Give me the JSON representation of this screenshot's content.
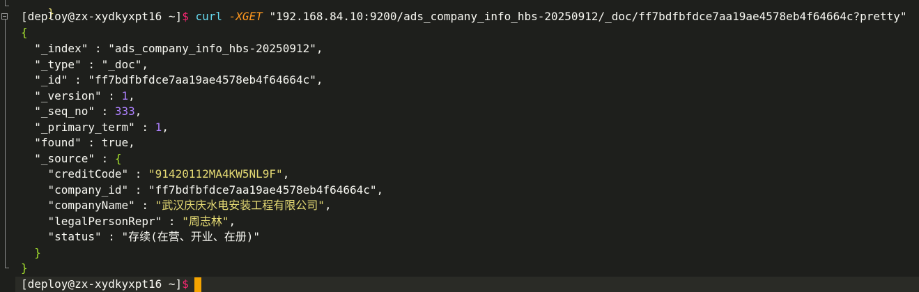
{
  "terminal": {
    "prompt": "[deploy@zx-xydkyxpt16 ~]",
    "prompt_symbol": "$",
    "command": {
      "program": "curl",
      "flag": "-XGET",
      "url": "\"192.168.84.10:9200/ads_company_info_hbs-20250912/_doc/ff7bdfbfdce7aa19ae4578eb4f64664c?pretty\""
    },
    "output": {
      "prev_brace": "}",
      "open_brace": "{",
      "close_brace": "}",
      "fields": [
        {
          "key": "\"_index\"",
          "sep": " : ",
          "value": "\"ads_company_info_hbs-20250912\"",
          "end": ","
        },
        {
          "key": "\"_type\"",
          "sep": " : ",
          "value": "\"_doc\"",
          "end": ","
        },
        {
          "key": "\"_id\"",
          "sep": " : ",
          "value": "\"ff7bdfbfdce7aa19ae4578eb4f64664c\"",
          "end": ","
        },
        {
          "key": "\"_version\"",
          "sep": " : ",
          "value": "1",
          "end": ","
        },
        {
          "key": "\"_seq_no\"",
          "sep": " : ",
          "value": "333",
          "end": ","
        },
        {
          "key": "\"_primary_term\"",
          "sep": " : ",
          "value": "1",
          "end": ","
        },
        {
          "key": "\"found\"",
          "sep": " : ",
          "value": "true",
          "end": ","
        },
        {
          "key": "\"_source\"",
          "sep": " : ",
          "value": "{",
          "end": ""
        }
      ],
      "source_fields": [
        {
          "key": "\"creditCode\"",
          "sep": " : ",
          "value": "\"91420112MA4KW5NL9F\"",
          "end": ","
        },
        {
          "key": "\"company_id\"",
          "sep": " : ",
          "value": "\"ff7bdfbfdce7aa19ae4578eb4f64664c\"",
          "end": ","
        },
        {
          "key": "\"companyName\"",
          "sep": " : ",
          "value": "\"武汉庆庆水电安装工程有限公司\"",
          "end": ","
        },
        {
          "key": "\"legalPersonRepr\"",
          "sep": " : ",
          "value": "\"周志林\"",
          "end": ","
        },
        {
          "key": "\"status\"",
          "sep": " : ",
          "value": "\"存续(在营、开业、在册)\"",
          "end": ""
        }
      ],
      "source_close": "}"
    }
  },
  "colors": {
    "background": "#1e1f1c",
    "key": "#f8f8f2",
    "string": "#e6db74",
    "number": "#ae81ff",
    "command": "#66d9ef",
    "flag": "#fd971f",
    "prompt_symbol": "#f92672",
    "cursor": "#f5a400"
  }
}
